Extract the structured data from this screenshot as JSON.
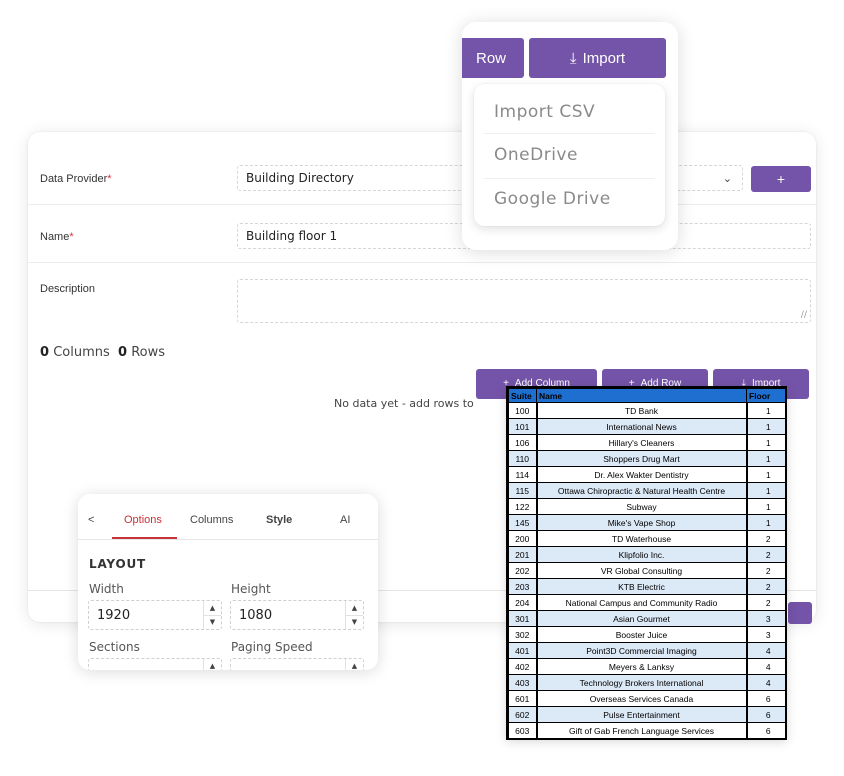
{
  "form": {
    "data_provider_label": "Data Provider",
    "data_provider_value": "Building Directory",
    "add_provider_label": "+",
    "name_label": "Name",
    "name_value": "Building floor 1",
    "description_label": "Description",
    "required_marker": "*",
    "columns_count": "0",
    "columns_label": "Columns",
    "rows_count": "0",
    "rows_label": "Rows",
    "add_column_label": "Add Column",
    "add_row_label": "Add Row",
    "import_label": "Import",
    "empty_message": "No data yet - add rows to"
  },
  "import_menu": {
    "row_button_label": "Row",
    "import_button_label": "Import",
    "items": [
      "Import CSV",
      "OneDrive",
      "Google Drive"
    ]
  },
  "options_panel": {
    "back_label": "<",
    "tabs": [
      "Options",
      "Columns",
      "Style",
      "AI"
    ],
    "active_tab": "Options",
    "section_title": "LAYOUT",
    "width_label": "Width",
    "width_value": "1920",
    "height_label": "Height",
    "height_value": "1080",
    "sections_label": "Sections",
    "paging_speed_label": "Paging Speed"
  },
  "directory_table": {
    "headers": [
      "Suite",
      "Name",
      "Floor"
    ],
    "rows": [
      [
        "100",
        "TD Bank",
        "1"
      ],
      [
        "101",
        "International News",
        "1"
      ],
      [
        "106",
        "Hillary's Cleaners",
        "1"
      ],
      [
        "110",
        "Shoppers Drug Mart",
        "1"
      ],
      [
        "114",
        "Dr. Alex Wakter Dentistry",
        "1"
      ],
      [
        "115",
        "Ottawa Chiropractic & Natural Health Centre",
        "1"
      ],
      [
        "122",
        "Subway",
        "1"
      ],
      [
        "145",
        "Mike's Vape Shop",
        "1"
      ],
      [
        "200",
        "TD Waterhouse",
        "2"
      ],
      [
        "201",
        "Klipfolio Inc.",
        "2"
      ],
      [
        "202",
        "VR Global Consulting",
        "2"
      ],
      [
        "203",
        "KTB Electric",
        "2"
      ],
      [
        "204",
        "National Campus and Community Radio",
        "2"
      ],
      [
        "301",
        "Asian Gourmet",
        "3"
      ],
      [
        "302",
        "Booster Juice",
        "3"
      ],
      [
        "401",
        "Point3D Commercial Imaging",
        "4"
      ],
      [
        "402",
        "Meyers & Lanksy",
        "4"
      ],
      [
        "403",
        "Technology Brokers International",
        "4"
      ],
      [
        "601",
        "Overseas Services Canada",
        "6"
      ],
      [
        "602",
        "Pulse Entertainment",
        "6"
      ],
      [
        "603",
        "Gift of Gab French Language Services",
        "6"
      ]
    ]
  },
  "colors": {
    "accent": "#7454a8",
    "active_tab": "#c8323a",
    "table_header": "#1f6fd0",
    "table_alt_row": "#dce9f7"
  }
}
